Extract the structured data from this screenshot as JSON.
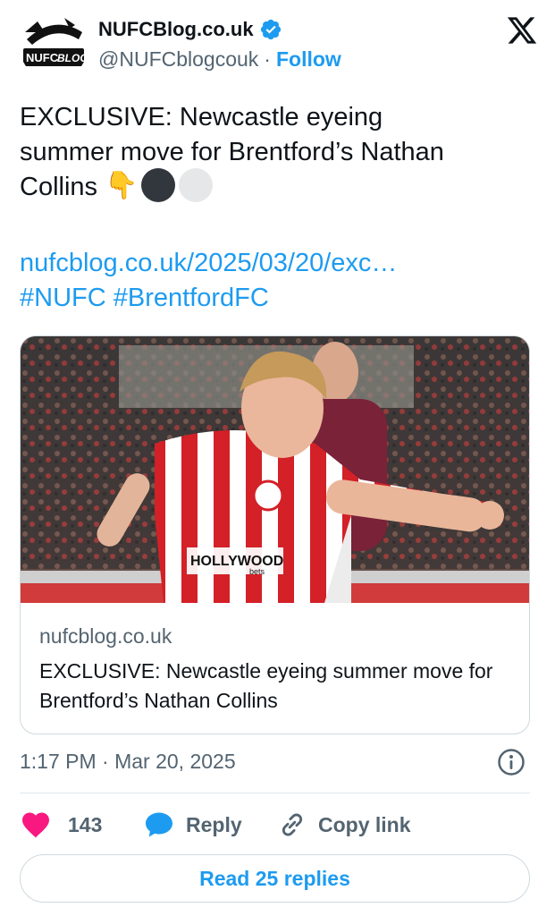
{
  "account": {
    "display_name": "NUFCBlog.co.uk",
    "handle": "@NUFCblogcouk",
    "separator": "·",
    "follow_label": "Follow",
    "avatar_text": "NUFC",
    "avatar_text_2": "BLOG"
  },
  "tweet": {
    "text_line_1": "EXCLUSIVE: Newcastle eyeing",
    "text_line_2": "summer move for Brentford’s Nathan",
    "text_line_3": "Collins",
    "emoji_pointing": "👇",
    "link_text": "nufcblog.co.uk/2025/03/20/exc…",
    "hashtags": "#NUFC #BrentfordFC"
  },
  "card": {
    "domain": "nufcblog.co.uk",
    "title": "EXCLUSIVE: Newcastle eyeing summer move for Brentford’s Nathan Collins",
    "image_sponsor": "HOLLYWOOD",
    "image_sponsor_sub": "bets"
  },
  "meta": {
    "timestamp": "1:17 PM · Mar 20, 2025"
  },
  "actions": {
    "like_count": "143",
    "reply_label": "Reply",
    "copy_link_label": "Copy link"
  },
  "footer": {
    "read_replies_label": "Read 25 replies"
  },
  "colors": {
    "accent": "#1d9bf0",
    "text": "#0f1419",
    "secondary": "#536471",
    "like": "#f91880",
    "dot_dark": "#31373d",
    "dot_light": "#e6e7e8"
  },
  "icons": {
    "verified": "verified-badge-icon",
    "x_logo": "x-logo-icon",
    "info": "info-icon",
    "like": "heart-icon",
    "reply": "speech-bubble-icon",
    "copy_link": "link-icon"
  }
}
